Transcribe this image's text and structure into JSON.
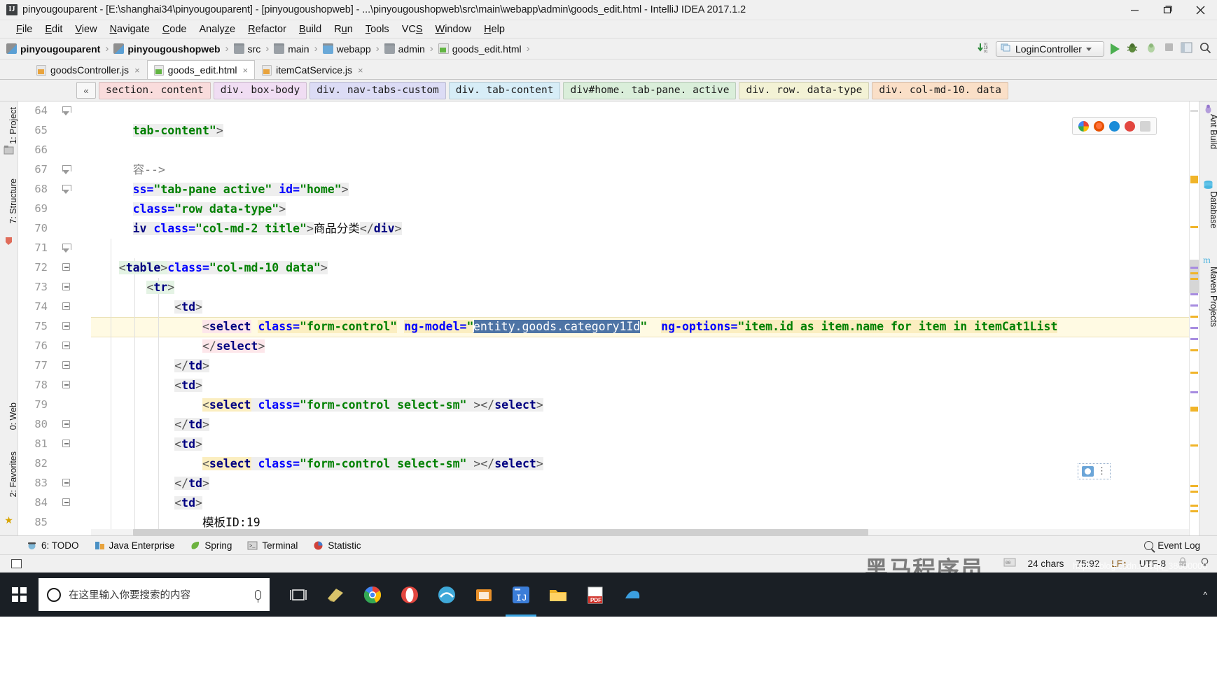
{
  "window": {
    "title": "pinyougouparent - [E:\\shanghai34\\pinyougouparent] - [pinyougoushopweb] - ...\\pinyougoushopweb\\src\\main\\webapp\\admin\\goods_edit.html - IntelliJ IDEA 2017.1.2",
    "app_icon": "IJ",
    "minimize": "minimize-icon",
    "maximize": "maximize-icon",
    "close": "close-icon"
  },
  "menubar": {
    "items": [
      "File",
      "Edit",
      "View",
      "Navigate",
      "Code",
      "Analyze",
      "Refactor",
      "Build",
      "Run",
      "Tools",
      "VCS",
      "Window",
      "Help"
    ]
  },
  "breadcrumb": {
    "items": [
      {
        "label": "pinyougouparent",
        "icon": "module-icon",
        "bold": true
      },
      {
        "label": "pinyougoushopweb",
        "icon": "module-icon",
        "bold": true
      },
      {
        "label": "src",
        "icon": "folder-icon",
        "bold": false
      },
      {
        "label": "main",
        "icon": "folder-icon",
        "bold": false
      },
      {
        "label": "webapp",
        "icon": "folder-blue-icon",
        "bold": false
      },
      {
        "label": "admin",
        "icon": "folder-icon",
        "bold": false
      },
      {
        "label": "goods_edit.html",
        "icon": "html-file-icon",
        "bold": false
      }
    ],
    "separator": "›"
  },
  "toolbar_right": {
    "update_icon": "update-project-icon",
    "run_config": "LoginController",
    "run_icon": "run-icon",
    "debug_icon": "debug-icon",
    "coverage_icon": "coverage-icon",
    "stop_icon": "stop-icon",
    "layout_icon": "layout-icon",
    "search_icon": "search-everywhere-icon"
  },
  "tabs": [
    {
      "label": "goodsController.js",
      "icon": "js-file-icon",
      "active": false,
      "close": "×"
    },
    {
      "label": "goods_edit.html",
      "icon": "html-file-icon",
      "active": true,
      "close": "×"
    },
    {
      "label": "itemCatService.js",
      "icon": "js-file-icon",
      "active": false,
      "close": "×"
    }
  ],
  "element_path": {
    "collapse_label": "«",
    "chips": [
      {
        "label": "section. content",
        "color": "#f9dcdc"
      },
      {
        "label": "div. box-body",
        "color": "#f0ddf3"
      },
      {
        "label": "div. nav-tabs-custom",
        "color": "#dcdcf5"
      },
      {
        "label": "div. tab-content",
        "color": "#d7edf7"
      },
      {
        "label": "div#home. tab-pane. active",
        "color": "#daeeda"
      },
      {
        "label": "div. row. data-type",
        "color": "#f3f2d5"
      },
      {
        "label": "div. col-md-10. data",
        "color": "#fadfc7"
      }
    ]
  },
  "left_tool_strip": {
    "items": [
      "1: Project",
      "7: Structure"
    ]
  },
  "right_tool_strip": {
    "items": [
      "Ant Build",
      "Database",
      "Maven Projects"
    ]
  },
  "bottom_left_strip": {
    "items": [
      "2: Favorites",
      "0: Web"
    ]
  },
  "editor": {
    "first_line": 64,
    "lines": [
      {
        "no": 64,
        "text": "tab-content\">"
      },
      {
        "no": 65,
        "text": ""
      },
      {
        "no": 66,
        "text": "容-->"
      },
      {
        "no": 67,
        "text": "ss=\"tab-pane active\" id=\"home\">"
      },
      {
        "no": 68,
        "text": "class=\"row data-type\">"
      },
      {
        "no": 69,
        "text": "iv class=\"col-md-2 title\">商品分类</div>"
      },
      {
        "no": 70,
        "text": ""
      },
      {
        "no": 71,
        "text": "<div class=\"col-md-10 data\">"
      },
      {
        "no": 72,
        "text": "<table>"
      },
      {
        "no": 73,
        "text": "<tr>"
      },
      {
        "no": 74,
        "text": "<td>"
      },
      {
        "no": 75,
        "text": "<select class=\"form-control\" ng-model=\"entity.goods.category1Id\" ng-options=\"item.id as item.name for item in itemCat1List"
      },
      {
        "no": 76,
        "text": "</select>"
      },
      {
        "no": 77,
        "text": "</td>"
      },
      {
        "no": 78,
        "text": "<td>"
      },
      {
        "no": 79,
        "text": "<select class=\"form-control select-sm\" ></select>"
      },
      {
        "no": 80,
        "text": "</td>"
      },
      {
        "no": 81,
        "text": "<td>"
      },
      {
        "no": 82,
        "text": "<select class=\"form-control select-sm\" ></select>"
      },
      {
        "no": 83,
        "text": "</td>"
      },
      {
        "no": 84,
        "text": "<td>"
      },
      {
        "no": 85,
        "text": "模板ID:19"
      }
    ],
    "selected_text": "entity.goods.category1Id",
    "highlighted_line": 75
  },
  "bottom_toolwindows": {
    "items": [
      {
        "label": "6: TODO",
        "icon": "todo-icon",
        "mnemonic": "6"
      },
      {
        "label": "Java Enterprise",
        "icon": "java-enterprise-icon"
      },
      {
        "label": "Spring",
        "icon": "spring-leaf-icon"
      },
      {
        "label": "Terminal",
        "icon": "terminal-icon"
      },
      {
        "label": "Statistic",
        "icon": "statistic-icon"
      }
    ],
    "event_log": "Event Log",
    "event_log_icon": "magnifier-icon"
  },
  "statusbar": {
    "toggle_icon": "toggle-toolwindows-icon",
    "chars": "24 chars",
    "caret_position": "75:92",
    "line_separator": "LF",
    "encoding": "UTF-8",
    "lock_icon": "read-only-icon",
    "inspection_icon": "inspection-icon",
    "watermark": "黑马程序员",
    "watermark_url": "https://blog.csdn.net/qq_38600000"
  },
  "taskbar": {
    "start_icon": "windows-start-icon",
    "search_placeholder": "在这里输入你要搜索的内容",
    "cortana_icon": "cortana-icon",
    "mic_icon": "microphone-icon",
    "taskview_icon": "task-view-icon",
    "pinned": [
      {
        "name": "editor-app-icon",
        "color": "#d9c36a"
      },
      {
        "name": "chrome-icon",
        "color": "#4285f4"
      },
      {
        "name": "opera-icon",
        "color": "#e2463f"
      },
      {
        "name": "ie-icon",
        "color": "#3fa9d9"
      },
      {
        "name": "folder-blue-icon",
        "color": "#e8902a"
      },
      {
        "name": "intellij-idea-icon",
        "color": "#3b7dd8"
      },
      {
        "name": "file-explorer-icon",
        "color": "#f0b429"
      },
      {
        "name": "pdf-reader-icon",
        "color": "#d0342c"
      },
      {
        "name": "misc-app-icon",
        "color": "#3b9fe0"
      }
    ]
  },
  "colors": {
    "accent_green": "#4caf50",
    "selection_blue": "#4e74a5",
    "highlight_yellow": "#fffae3",
    "taskbar_bg": "#1a1f25",
    "chrome_bg": "#f0f0f0"
  }
}
